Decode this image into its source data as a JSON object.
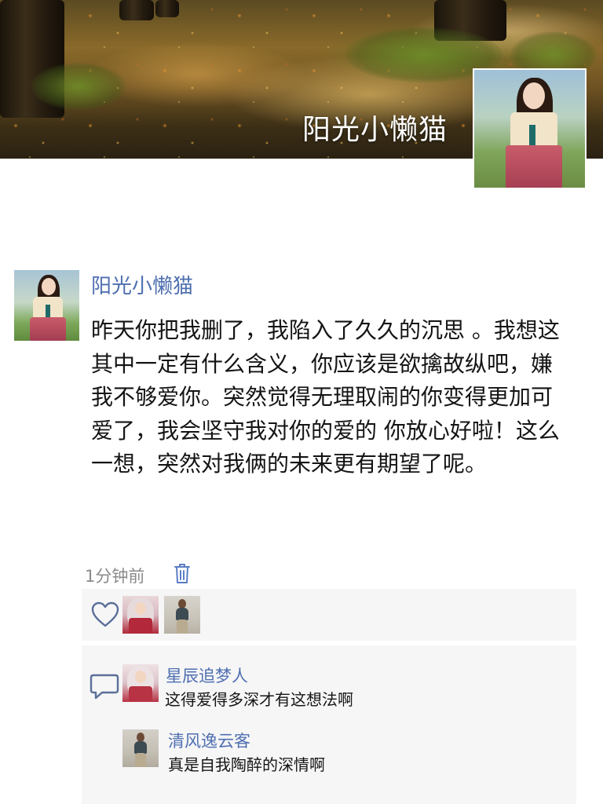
{
  "cover": {
    "username": "阳光小懒猫"
  },
  "post": {
    "author": "阳光小懒猫",
    "text": "昨天你把我删了，我陷入了久久的沉思 。我想这其中一定有什么含义，你应该是欲擒故纵吧，嫌我不够爱你。突然觉得无理取闹的你变得更加可爱了，我会坚守我对你的爱的 你放心好啦！这么一想，突然对我俩的未来更有期望了呢。",
    "time": "1分钟前"
  },
  "likes": {
    "icon": "heart-icon"
  },
  "comments": [
    {
      "author": "星辰追梦人",
      "text": "这得爱得多深才有这想法啊"
    },
    {
      "author": "清风逸云客",
      "text": "真是自我陶醉的深情啊"
    }
  ],
  "colors": {
    "name_link": "#4f6fb0",
    "panel_bg": "#f6f6f7",
    "meta_text": "#8a8a8a"
  }
}
